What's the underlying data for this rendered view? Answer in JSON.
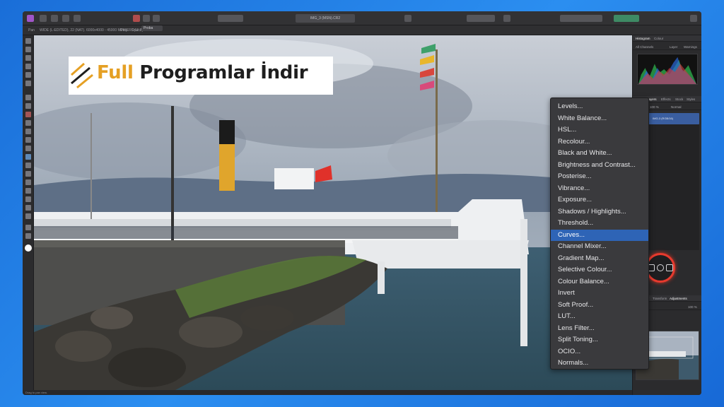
{
  "app": {
    "document_title": "IMG_3 (MSN).CR2",
    "context_bar": {
      "items": [
        "Pan",
        "WIDE (L-EDITED), 22 (NAT). 6000x4000 - 45000 MPIXERS 12.7",
        "Dirty",
        "Opacity",
        "Blend"
      ],
      "opacity_value": "Proba"
    },
    "status_text": "Drag to pan view."
  },
  "banner": {
    "word1": "Full",
    "word2": " Programlar İndir",
    "accent_color": "#e5a024"
  },
  "right_panel": {
    "tabs_top": [
      "Histogram",
      "Colour"
    ],
    "histogram_controls": [
      "All Channels",
      "Layer",
      "Warnings"
    ],
    "layers_tabs": [
      "Adj",
      "Layers",
      "Effects",
      "Stock",
      "Styles"
    ],
    "opacity_label": "Opacity",
    "opacity_value": "100 %",
    "blend_label": "Normal",
    "layer_name": "IMG-3 (RGB/16)",
    "bottom_tabs": [
      "Navigator",
      "Transform",
      "Adjustments"
    ],
    "zoom_value": "100 %",
    "highlight_color": "#e63a2e"
  },
  "adjustment_menu": {
    "selected_index": 11,
    "items": [
      "Levels...",
      "White Balance...",
      "HSL...",
      "Recolour...",
      "Black and White...",
      "Brightness and Contrast...",
      "Posterise...",
      "Vibrance...",
      "Exposure...",
      "Shadows / Highlights...",
      "Threshold...",
      "Curves...",
      "Channel Mixer...",
      "Gradient Map...",
      "Selective Colour...",
      "Colour Balance...",
      "Invert",
      "Soft Proof...",
      "LUT...",
      "Lens Filter...",
      "Split Toning...",
      "OCIO...",
      "Normals..."
    ]
  }
}
